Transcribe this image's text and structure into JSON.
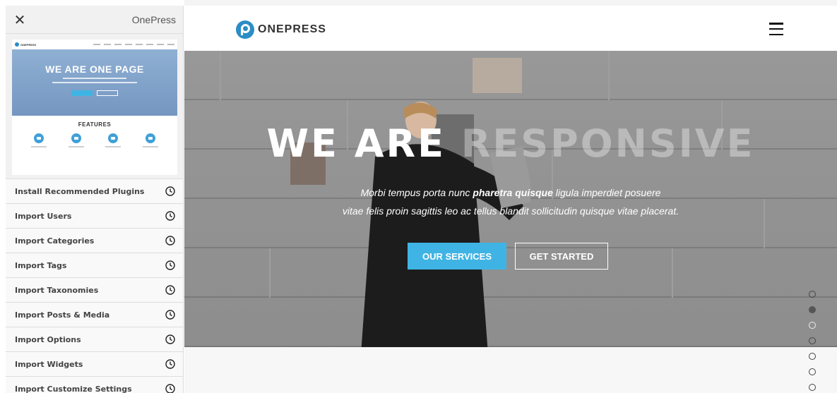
{
  "panel": {
    "title": "OnePress",
    "close_icon": "close-icon",
    "preview": {
      "logo_text": "ONEPRESS",
      "hero_title": "WE ARE ONE PAGE",
      "section_title": "FEATURES",
      "accent_color": "#3fb4e4"
    },
    "steps": [
      {
        "label": "Install Recommended Plugins",
        "icon": "clock-icon"
      },
      {
        "label": "Import Users",
        "icon": "clock-icon"
      },
      {
        "label": "Import Categories",
        "icon": "clock-icon"
      },
      {
        "label": "Import Tags",
        "icon": "clock-icon"
      },
      {
        "label": "Import Taxonomies",
        "icon": "clock-icon"
      },
      {
        "label": "Import Posts & Media",
        "icon": "clock-icon"
      },
      {
        "label": "Import Options",
        "icon": "clock-icon"
      },
      {
        "label": "Import Widgets",
        "icon": "clock-icon"
      },
      {
        "label": "Import Customize Settings",
        "icon": "clock-icon"
      }
    ]
  },
  "site": {
    "logo_text": "ONEPRESS",
    "brand_color": "#2b8dc6",
    "menu_icon": "hamburger-menu-icon",
    "hero": {
      "title_strong": "WE ARE",
      "title_faded": "RESPONSIVE",
      "subtitle_line1_pre": "Morbi tempus porta nunc ",
      "subtitle_line1_bold": "pharetra quisque",
      "subtitle_line1_post": " ligula imperdiet posuere",
      "subtitle_line2": "vitae felis proin sagittis leo ac tellus blandit sollicitudin quisque vitae placerat.",
      "primary_button": "OUR SERVICES",
      "secondary_button": "GET STARTED",
      "primary_color": "#3fb4e4"
    },
    "section_dots": {
      "count": 7,
      "active_index": 1
    }
  }
}
